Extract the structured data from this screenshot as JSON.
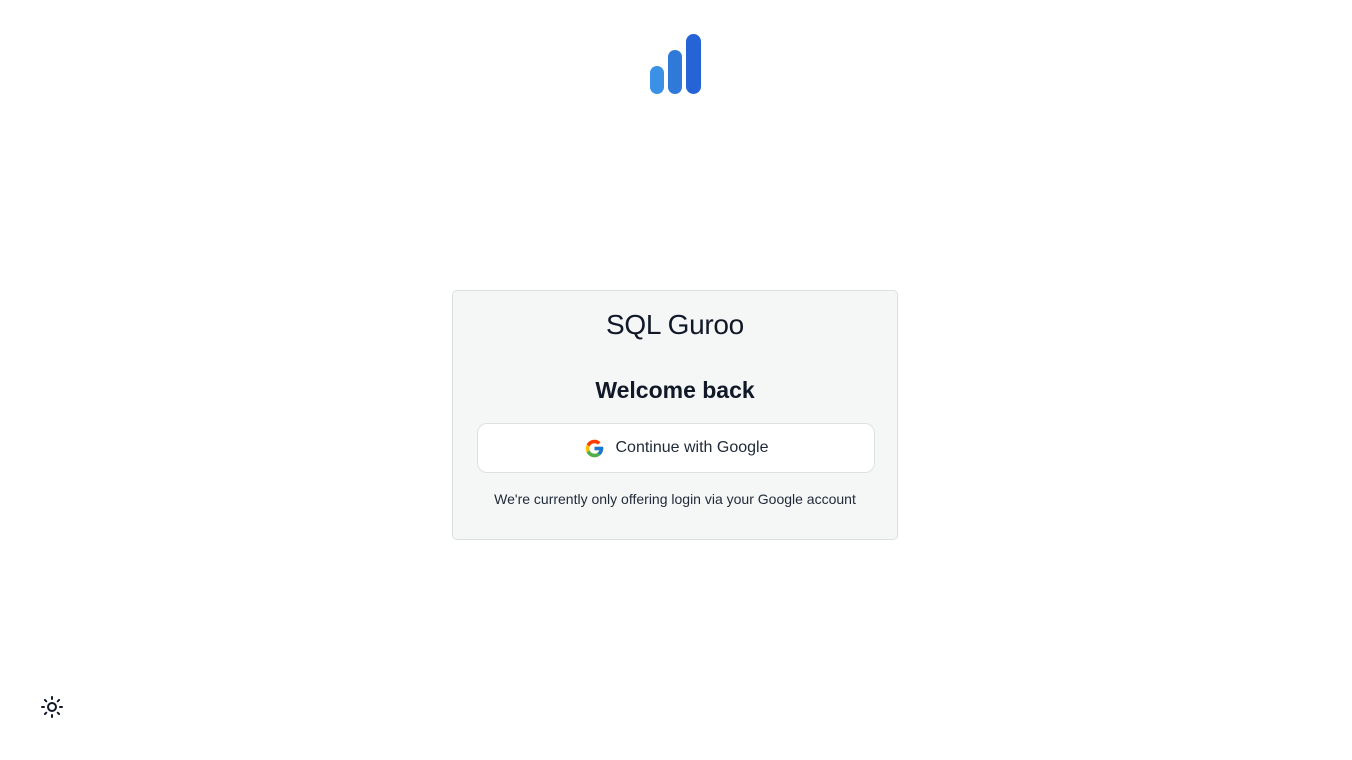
{
  "brand": {
    "name": "SQL Guroo",
    "logo_icon": "bar-chart-logo-icon",
    "logo_colors": [
      "#3b91e6",
      "#2f7ad9",
      "#2563d6"
    ]
  },
  "login": {
    "heading": "Welcome back",
    "google_button_label": "Continue with Google",
    "google_icon": "google-icon",
    "note": "We're currently only offering login via your Google account"
  },
  "theme_toggle": {
    "icon": "sun-icon"
  }
}
